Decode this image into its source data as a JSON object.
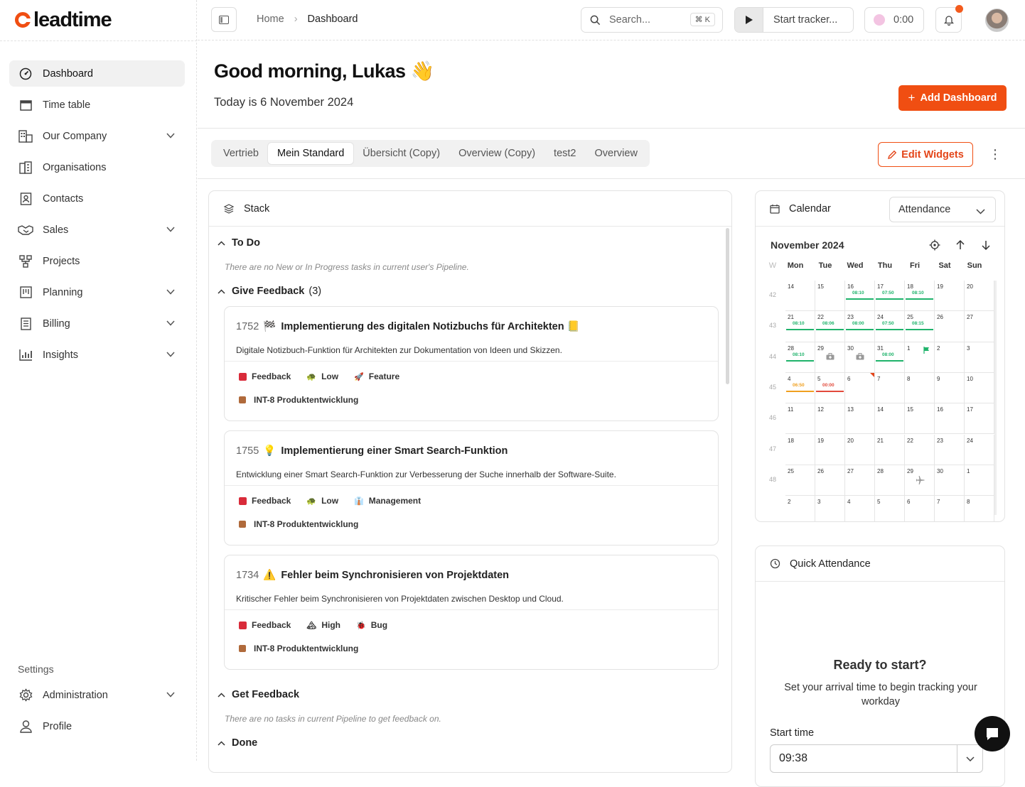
{
  "app": {
    "logo_text": "leadtime",
    "brand_color": "#f04e12"
  },
  "sidebar": {
    "items": [
      {
        "label": "Dashboard",
        "icon": "dashboard-icon",
        "active": true
      },
      {
        "label": "Time table",
        "icon": "calendar-icon"
      },
      {
        "label": "Our Company",
        "icon": "building-icon",
        "expandable": true
      },
      {
        "label": "Organisations",
        "icon": "office-icon"
      },
      {
        "label": "Contacts",
        "icon": "contacts-icon"
      },
      {
        "label": "Sales",
        "icon": "handshake-icon",
        "expandable": true
      },
      {
        "label": "Projects",
        "icon": "projects-icon"
      },
      {
        "label": "Planning",
        "icon": "planning-icon",
        "expandable": true
      },
      {
        "label": "Billing",
        "icon": "billing-icon",
        "expandable": true
      },
      {
        "label": "Insights",
        "icon": "chart-icon",
        "expandable": true
      }
    ],
    "settings_label": "Settings",
    "settings_items": [
      {
        "label": "Administration",
        "icon": "gear-icon",
        "expandable": true
      },
      {
        "label": "Profile",
        "icon": "user-icon"
      }
    ]
  },
  "topbar": {
    "breadcrumb": [
      "Home",
      "Dashboard"
    ],
    "search_placeholder": "Search...",
    "search_shortcut": "⌘ K",
    "tracker_label": "Start tracker...",
    "timer": "0:00"
  },
  "main": {
    "greeting": "Good morning, Lukas",
    "greeting_emoji": "👋",
    "today": "Today is 6 November 2024",
    "add_dashboard": "Add Dashboard",
    "edit_widgets": "Edit Widgets",
    "tabs": [
      "Vertrieb",
      "Mein Standard",
      "Übersicht (Copy)",
      "Overview (Copy)",
      "test2",
      "Overview"
    ],
    "active_tab": 1
  },
  "stack": {
    "title": "Stack",
    "todo": {
      "label": "To Do",
      "empty": "There are no New or In Progress tasks in current user's Pipeline."
    },
    "give_feedback": {
      "label": "Give Feedback",
      "count": "(3)"
    },
    "cards": [
      {
        "id": "1752",
        "emoji": "🏁",
        "title": "Implementierung des digitalen Notizbuchs für Architekten",
        "trail_emoji": "📒",
        "desc": "Digitale Notizbuch-Funktion für Architekten zur Dokumentation von Ideen und Skizzen.",
        "status": "Feedback",
        "priority": "Low",
        "priority_icon": "🐢",
        "type": "Feature",
        "type_icon": "🚀",
        "project": "INT-8 Produktentwicklung"
      },
      {
        "id": "1755",
        "emoji": "💡",
        "title": "Implementierung einer Smart Search-Funktion",
        "trail_emoji": "",
        "desc": "Entwicklung einer Smart Search-Funktion zur Verbesserung der Suche innerhalb der Software-Suite.",
        "status": "Feedback",
        "priority": "Low",
        "priority_icon": "🐢",
        "type": "Management",
        "type_icon": "👔",
        "project": "INT-8 Produktentwicklung"
      },
      {
        "id": "1734",
        "emoji": "⚠️",
        "title": "Fehler beim Synchronisieren von Projektdaten",
        "trail_emoji": "",
        "desc": "Kritischer Fehler beim Synchronisieren von Projektdaten zwischen Desktop und Cloud.",
        "status": "Feedback",
        "priority": "High",
        "priority_icon": "🏔",
        "type": "Bug",
        "type_icon": "🐞",
        "project": "INT-8 Produktentwicklung"
      }
    ],
    "get_feedback": {
      "label": "Get Feedback",
      "empty": "There are no tasks in current Pipeline to get feedback on."
    },
    "done": {
      "label": "Done"
    }
  },
  "calendar": {
    "title": "Calendar",
    "mode": "Attendance",
    "month": "November 2024",
    "week_col": "W",
    "days": [
      "Mon",
      "Tue",
      "Wed",
      "Thu",
      "Fri",
      "Sat",
      "Sun"
    ],
    "weeks": [
      {
        "wk": "42",
        "days": [
          {
            "d": "14"
          },
          {
            "d": "15"
          },
          {
            "d": "16",
            "h": "08:10",
            "c": "green"
          },
          {
            "d": "17",
            "h": "07:50",
            "c": "green"
          },
          {
            "d": "18",
            "h": "08:10",
            "c": "green"
          },
          {
            "d": "19"
          },
          {
            "d": "20"
          }
        ]
      },
      {
        "wk": "43",
        "days": [
          {
            "d": "21",
            "h": "08:10",
            "c": "green"
          },
          {
            "d": "22",
            "h": "08:06",
            "c": "green"
          },
          {
            "d": "23",
            "h": "08:00",
            "c": "green"
          },
          {
            "d": "24",
            "h": "07:50",
            "c": "green"
          },
          {
            "d": "25",
            "h": "08:15",
            "c": "green"
          },
          {
            "d": "26"
          },
          {
            "d": "27"
          }
        ]
      },
      {
        "wk": "44",
        "days": [
          {
            "d": "28",
            "h": "08:10",
            "c": "green"
          },
          {
            "d": "29",
            "icon": "medical-bag-icon"
          },
          {
            "d": "30",
            "icon": "medical-bag-icon"
          },
          {
            "d": "31",
            "h": "08:00",
            "c": "green"
          },
          {
            "d": "1",
            "icon": "flag-icon"
          },
          {
            "d": "2"
          },
          {
            "d": "3"
          }
        ]
      },
      {
        "wk": "45",
        "days": [
          {
            "d": "4",
            "h": "06:50",
            "c": "orange"
          },
          {
            "d": "5",
            "h": "00:00",
            "c": "red"
          },
          {
            "d": "6",
            "today": true
          },
          {
            "d": "7"
          },
          {
            "d": "8"
          },
          {
            "d": "9"
          },
          {
            "d": "10"
          }
        ]
      },
      {
        "wk": "46",
        "days": [
          {
            "d": "11"
          },
          {
            "d": "12"
          },
          {
            "d": "13"
          },
          {
            "d": "14"
          },
          {
            "d": "15"
          },
          {
            "d": "16"
          },
          {
            "d": "17"
          }
        ]
      },
      {
        "wk": "47",
        "days": [
          {
            "d": "18"
          },
          {
            "d": "19"
          },
          {
            "d": "20"
          },
          {
            "d": "21"
          },
          {
            "d": "22"
          },
          {
            "d": "23"
          },
          {
            "d": "24"
          }
        ]
      },
      {
        "wk": "48",
        "days": [
          {
            "d": "25"
          },
          {
            "d": "26"
          },
          {
            "d": "27"
          },
          {
            "d": "28"
          },
          {
            "d": "29",
            "icon": "plane-icon"
          },
          {
            "d": "30"
          },
          {
            "d": "1"
          }
        ]
      },
      {
        "wk": "",
        "days": [
          {
            "d": "2"
          },
          {
            "d": "3"
          },
          {
            "d": "4"
          },
          {
            "d": "5"
          },
          {
            "d": "6"
          },
          {
            "d": "7"
          },
          {
            "d": "8"
          }
        ]
      }
    ]
  },
  "quick_attendance": {
    "title": "Quick Attendance",
    "heading": "Ready to start?",
    "sub": "Set your arrival time to begin tracking your workday",
    "start_label": "Start time",
    "start_value": "09:38"
  }
}
